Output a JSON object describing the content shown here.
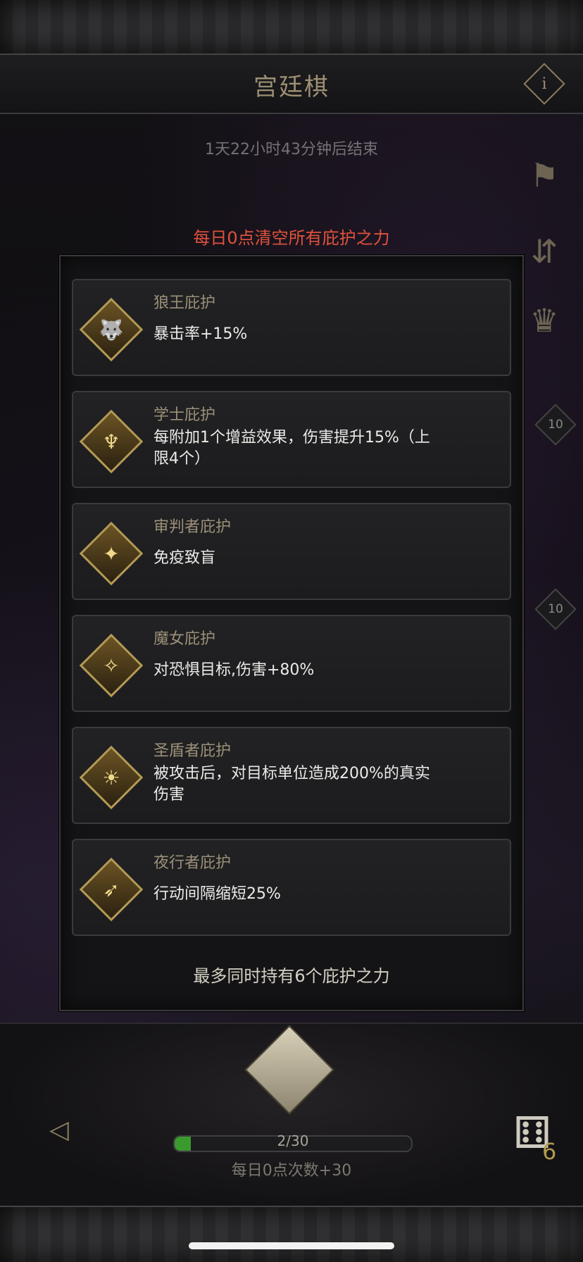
{
  "header": {
    "title": "宫廷棋",
    "info_label": "i",
    "timer": "1天22小时43分钟后结束"
  },
  "notice": "每日0点清空所有庇护之力",
  "side_icons": [
    "banner-icon",
    "swap-icon",
    "trophy-icon"
  ],
  "tile_badges": [
    "10",
    "10"
  ],
  "blessings": [
    {
      "name": "狼王庇护",
      "desc": "暴击率+15%",
      "icon": "wolf-icon",
      "glyph": "🐺"
    },
    {
      "name": "学士庇护",
      "desc": "每附加1个增益效果，伤害提升15%（上限4个）",
      "icon": "scholar-icon",
      "glyph": "♆"
    },
    {
      "name": "审判者庇护",
      "desc": "免疫致盲",
      "icon": "judge-icon",
      "glyph": "✦"
    },
    {
      "name": "魔女庇护",
      "desc": "对恐惧目标,伤害+80%",
      "icon": "witch-icon",
      "glyph": "✧"
    },
    {
      "name": "圣盾者庇护",
      "desc": "被攻击后，对目标单位造成200%的真实伤害",
      "icon": "shield-icon",
      "glyph": "☀"
    },
    {
      "name": "夜行者庇护",
      "desc": "行动间隔缩短25%",
      "icon": "nightwalker-icon",
      "glyph": "➶"
    }
  ],
  "panel_footer": "最多同时持有6个庇护之力",
  "bottom": {
    "progress_text": "2/30",
    "progress_fraction": 0.067,
    "daily_text": "每日0点次数+30",
    "dice_count": "6",
    "back_glyph": "◁",
    "dice_glyph": "⚅"
  },
  "colors": {
    "notice": "#e0523d",
    "gold": "#b59a55",
    "progress": "#3a9a2e"
  }
}
